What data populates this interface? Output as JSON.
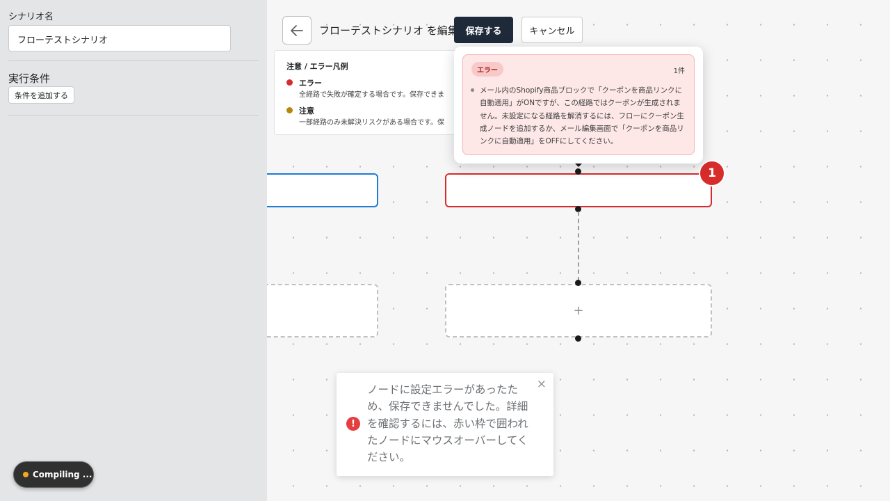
{
  "sidebar": {
    "scenario_name_label": "シナリオ名",
    "scenario_name_value": "フローテストシナリオ",
    "conditions_heading": "実行条件",
    "add_condition_label": "条件を追加する"
  },
  "status": {
    "compiling_label": "Compiling ..."
  },
  "toolbar": {
    "editing_title": "フローテストシナリオ を編集中",
    "save_label": "保存する",
    "cancel_label": "キャンセル"
  },
  "legend": {
    "title": "注意 / エラー凡例",
    "items": [
      {
        "name": "エラー",
        "desc": "全経路で失敗が確定する場合です。保存できま",
        "color": "#d72c2c"
      },
      {
        "name": "注意",
        "desc": "一部経路のみ未解決リスクがある場合です。保",
        "color": "#b8860b"
      }
    ]
  },
  "node_error": {
    "badge_count": "1"
  },
  "add_node": {
    "plus_label": "+"
  },
  "error_popover": {
    "pill_label": "エラー",
    "count_label": "1件",
    "message": "メール内のShopify商品ブロックで「クーポンを商品リンクに自動適用」がONですが、この経路ではクーポンが生成されません。未設定になる経路を解消するには、フローにクーポン生成ノードを追加するか、メール編集画面で「クーポンを商品リンクに自動適用」をOFFにしてください。"
  },
  "toast": {
    "icon_glyph": "!",
    "close_glyph": "×",
    "message": "ノードに設定エラーがあったため、保存できませんでした。詳細を確認するには、赤い枠で囲われたノードにマウスオーバーしてください。"
  },
  "colors": {
    "error": "#d72c2c",
    "warning": "#b8860b",
    "selected": "#1f7ad8",
    "primary_button": "#1e2a3a"
  }
}
